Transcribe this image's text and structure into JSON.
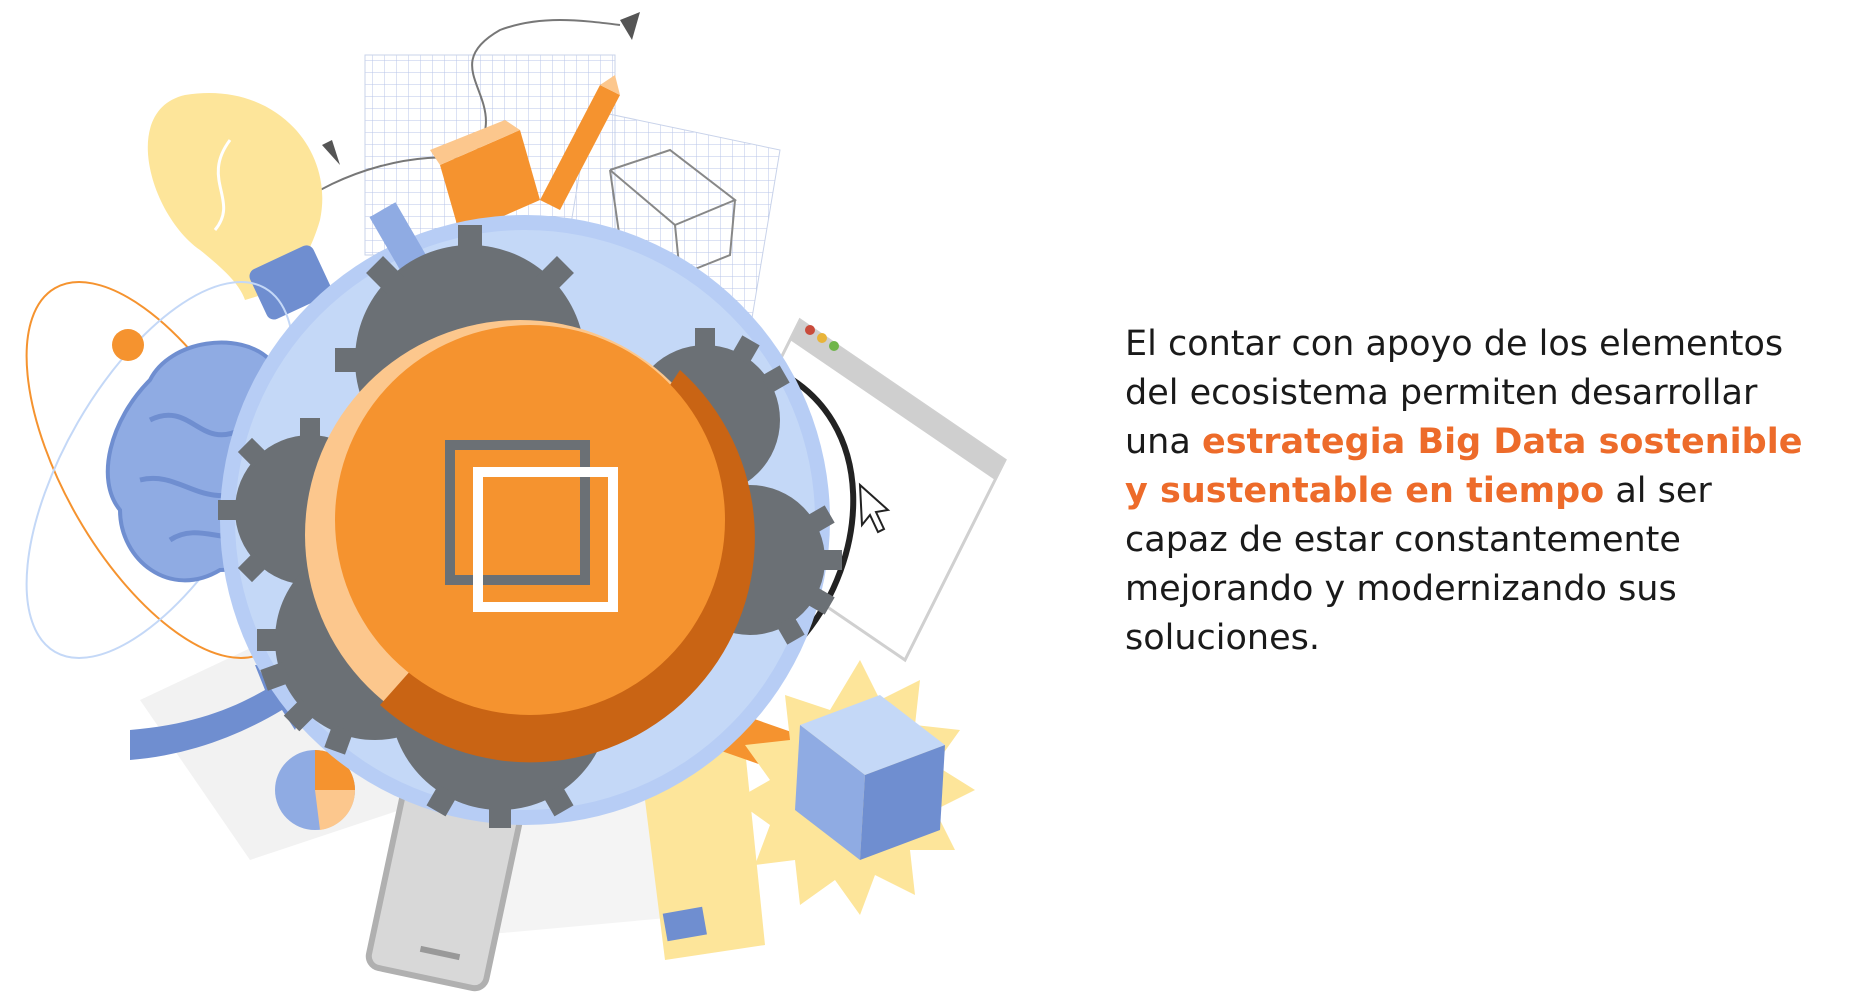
{
  "paragraph": {
    "part1": "El contar con apoyo de los elementos del ecosistema permiten desarrollar una",
    "highlight": "estrategia Big Data sostenible y sustentable en tiempo",
    "part2": "al ser capaz de estar constantemente mejorando y modernizando sus soluciones."
  },
  "colors": {
    "accent": "#ed6b2a",
    "orange": "#f5932f",
    "light_blue": "#c4d8f7",
    "mid_blue": "#6f8ed0",
    "gear_gray": "#6b7075",
    "bulb_yellow": "#fde59a"
  },
  "illustration": {
    "icons": [
      "light-bulb-icon",
      "brain-icon",
      "gear-icon",
      "pencil-icon",
      "cube-icon",
      "pie-chart-icon",
      "smartphone-icon",
      "browser-window-icon",
      "cursor-icon",
      "arrow-icon"
    ]
  }
}
